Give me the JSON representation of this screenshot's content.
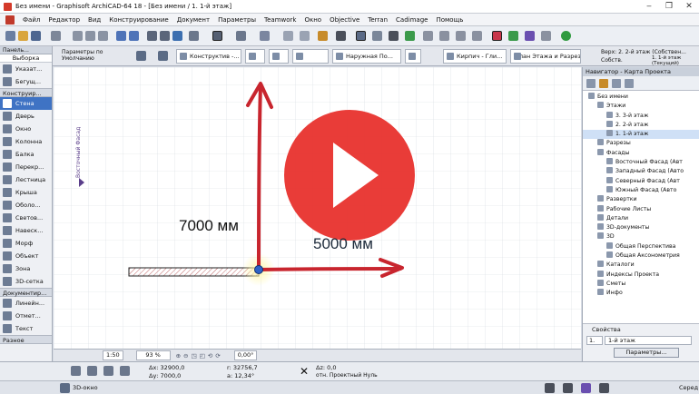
{
  "window": {
    "title": "Без имени - Graphisoft ArchiCAD-64 18 - [Без имени / 1. 1-й этаж]",
    "controls": [
      "‒",
      "❐",
      "✕"
    ]
  },
  "menu": [
    "Файл",
    "Редактор",
    "Вид",
    "Конструирование",
    "Документ",
    "Параметры",
    "Teamwork",
    "Окно",
    "Objective",
    "Terran",
    "Cadimage",
    "Помощь"
  ],
  "infobox": {
    "defaults_label": "Параметры по Умолчанию",
    "fields": [
      "Конструктив -...",
      "Наружная По...",
      "Кирпич - Гли...",
      "План Этажа и Разрез..."
    ],
    "story_top": "Верх: 2. 2-й этаж (Собствен...",
    "story_own": "Собств.",
    "story_own_value": "1. 1-й этаж (Текущий)"
  },
  "toolbox": {
    "header": "Панель...",
    "selection": "Выборка",
    "tools_top": [
      "Указат...",
      "Бегущ..."
    ],
    "design_section": "Конструир...",
    "design_tools": [
      "Стена",
      "Дверь",
      "Окно",
      "Колонна",
      "Балка",
      "Перекр...",
      "Лестница",
      "Крыша",
      "Оболо...",
      "Светов...",
      "Навеск...",
      "Морф",
      "Объект",
      "Зона",
      "3D-сетка"
    ],
    "doc_section": "Документир...",
    "doc_tools": [
      "Линейн...",
      "Отмет...",
      "Текст"
    ],
    "misc_section": "Разное",
    "active_tool": "Стена"
  },
  "canvas": {
    "elevation_marker": "Восточный Фасад",
    "label_vertical": "7000 мм",
    "label_horizontal": "5000 мм",
    "colors": {
      "arrow": "#c8252e",
      "play": "#e8312d",
      "hatch": "#c26a6a"
    }
  },
  "statusbar": {
    "scale": "1:50",
    "zoom": "93 %",
    "angle": "0,00°"
  },
  "navigator": {
    "header": "Навигатор - Карта Проекта",
    "tree": [
      {
        "label": "Без имени",
        "level": 0
      },
      {
        "label": "Этажи",
        "level": 1
      },
      {
        "label": "3. 3-й этаж",
        "level": 2
      },
      {
        "label": "2. 2-й этаж",
        "level": 2
      },
      {
        "label": "1. 1-й этаж",
        "level": 2,
        "selected": true
      },
      {
        "label": "Разрезы",
        "level": 1
      },
      {
        "label": "Фасады",
        "level": 1
      },
      {
        "label": "Восточный Фасад (Авт",
        "level": 2
      },
      {
        "label": "Западный Фасад (Авто",
        "level": 2
      },
      {
        "label": "Северный Фасад (Авт",
        "level": 2
      },
      {
        "label": "Южный Фасад (Авто",
        "level": 2
      },
      {
        "label": "Развертки",
        "level": 1
      },
      {
        "label": "Рабочие Листы",
        "level": 1
      },
      {
        "label": "Детали",
        "level": 1
      },
      {
        "label": "3D-документы",
        "level": 1
      },
      {
        "label": "3D",
        "level": 1
      },
      {
        "label": "Общая Перспектива",
        "level": 2
      },
      {
        "label": "Общая Аксонометрия",
        "level": 2
      },
      {
        "label": "Каталоги",
        "level": 1
      },
      {
        "label": "Индексы Проекта",
        "level": 1
      },
      {
        "label": "Сметы",
        "level": 1
      },
      {
        "label": "Инфо",
        "level": 1
      }
    ],
    "props_title": "Свойства",
    "props_number": "1.",
    "props_value": "1-й этаж",
    "props_button": "Параметры..."
  },
  "coords": {
    "dx": "Δх: 32900,0",
    "dy": "Δу: 7000,0",
    "r": "r: 32756,7",
    "a": "a: 12,34°",
    "dz": "Δz: 0,0",
    "ref": "отн. Проектный Нуль"
  },
  "bottombar": {
    "view3d": "3D-окно",
    "right": "Серед"
  }
}
